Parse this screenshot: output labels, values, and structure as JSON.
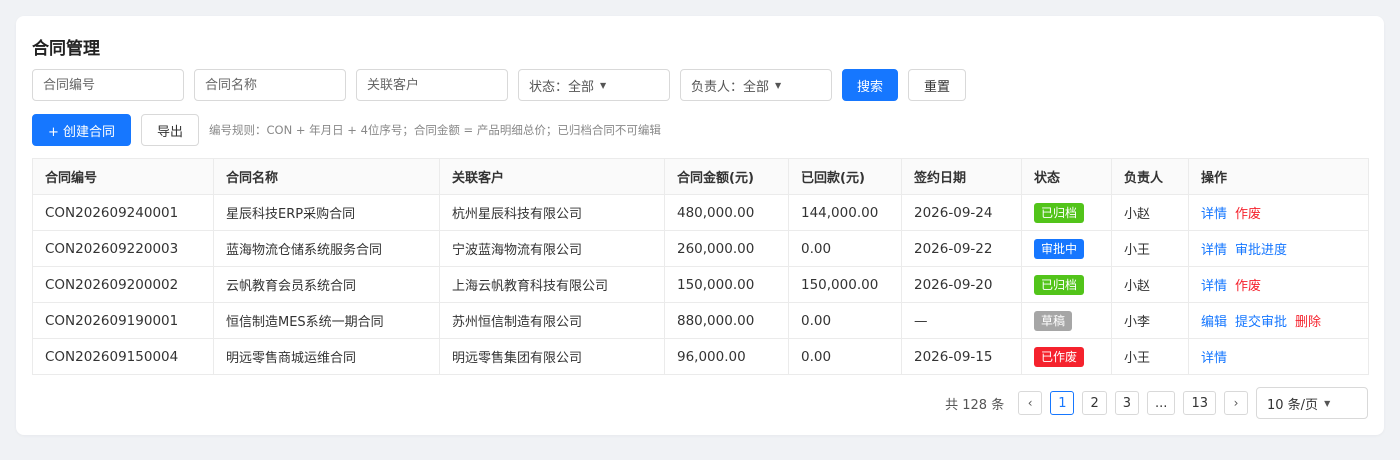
{
  "page": {
    "title": "合同管理"
  },
  "filters": {
    "contract_no_placeholder": "合同编号",
    "contract_name_placeholder": "合同名称",
    "customer_placeholder": "关联客户",
    "status_label": "状态：全部",
    "owner_label": "负责人：全部",
    "search_label": "搜索",
    "reset_label": "重置"
  },
  "actions": {
    "create_label": "+ 创建合同",
    "export_label": "导出",
    "hint": "编号规则：CON + 年月日 + 4位序号；合同金额 = 产品明细总价；已归档合同不可编辑"
  },
  "colors": {
    "primary": "#1677ff",
    "danger": "#f5222d",
    "archived": "#52c41a",
    "reviewing": "#1677ff",
    "draft": "#a6a6a6",
    "voided": "#f5222d"
  },
  "table": {
    "headers": [
      "合同编号",
      "合同名称",
      "关联客户",
      "合同金额(元)",
      "已回款(元)",
      "签约日期",
      "状态",
      "负责人",
      "操作"
    ],
    "rows": [
      {
        "no": "CON202609240001",
        "name": "星辰科技ERP采购合同",
        "customer": "杭州星辰科技有限公司",
        "amount": "480,000.00",
        "received": "144,000.00",
        "date": "2026-09-24",
        "status": "已归档",
        "status_color": "#52c41a",
        "owner": "小赵",
        "ops": [
          {
            "label": "详情",
            "type": "link"
          },
          {
            "label": "作废",
            "type": "danger"
          }
        ]
      },
      {
        "no": "CON202609220003",
        "name": "蓝海物流仓储系统服务合同",
        "customer": "宁波蓝海物流有限公司",
        "amount": "260,000.00",
        "received": "0.00",
        "date": "2026-09-22",
        "status": "审批中",
        "status_color": "#1677ff",
        "owner": "小王",
        "ops": [
          {
            "label": "详情",
            "type": "link"
          },
          {
            "label": "审批进度",
            "type": "link"
          }
        ]
      },
      {
        "no": "CON202609200002",
        "name": "云帆教育会员系统合同",
        "customer": "上海云帆教育科技有限公司",
        "amount": "150,000.00",
        "received": "150,000.00",
        "date": "2026-09-20",
        "status": "已归档",
        "status_color": "#52c41a",
        "owner": "小赵",
        "ops": [
          {
            "label": "详情",
            "type": "link"
          },
          {
            "label": "作废",
            "type": "danger"
          }
        ]
      },
      {
        "no": "CON202609190001",
        "name": "恒信制造MES系统一期合同",
        "customer": "苏州恒信制造有限公司",
        "amount": "880,000.00",
        "received": "0.00",
        "date": "—",
        "status": "草稿",
        "status_color": "#a6a6a6",
        "owner": "小李",
        "ops": [
          {
            "label": "编辑",
            "type": "link"
          },
          {
            "label": "提交审批",
            "type": "link"
          },
          {
            "label": "删除",
            "type": "danger"
          }
        ]
      },
      {
        "no": "CON202609150004",
        "name": "明远零售商城运维合同",
        "customer": "明远零售集团有限公司",
        "amount": "96,000.00",
        "received": "0.00",
        "date": "2026-09-15",
        "status": "已作废",
        "status_color": "#f5222d",
        "owner": "小王",
        "ops": [
          {
            "label": "详情",
            "type": "link"
          }
        ]
      }
    ]
  },
  "pagination": {
    "total": "共 128 条",
    "prev": "‹",
    "next": "›",
    "pages": [
      "1",
      "2",
      "3",
      "...",
      "13"
    ],
    "current": "1",
    "page_size": "10 条/页"
  }
}
